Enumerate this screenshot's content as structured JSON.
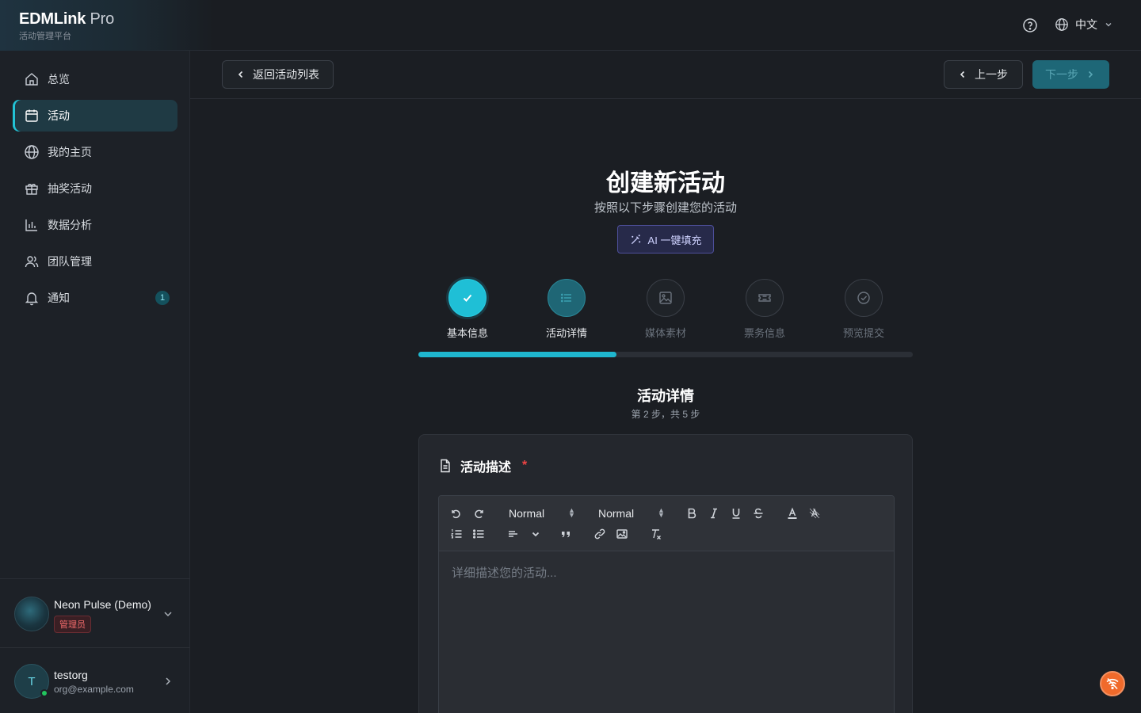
{
  "brand": {
    "name": "EDMLink",
    "suffix": "Pro",
    "subtitle": "活动管理平台"
  },
  "header": {
    "language": "中文"
  },
  "sidebar": {
    "items": [
      {
        "label": "总览",
        "icon": "home-icon"
      },
      {
        "label": "活动",
        "icon": "calendar-icon",
        "active": true
      },
      {
        "label": "我的主页",
        "icon": "globe-icon"
      },
      {
        "label": "抽奖活动",
        "icon": "gift-icon"
      },
      {
        "label": "数据分析",
        "icon": "bar-chart-icon"
      },
      {
        "label": "团队管理",
        "icon": "users-icon"
      },
      {
        "label": "通知",
        "icon": "bell-icon",
        "badge": "1"
      }
    ],
    "org": {
      "name": "Neon Pulse (Demo)",
      "role": "管理员"
    },
    "user": {
      "initial": "T",
      "name": "testorg",
      "email": "org@example.com"
    }
  },
  "actions": {
    "back": "返回活动列表",
    "prev": "上一步",
    "next": "下一步"
  },
  "page": {
    "title": "创建新活动",
    "subtitle": "按照以下步骤创建您的活动",
    "ai_fill": "AI 一键填充"
  },
  "steps": [
    {
      "label": "基本信息",
      "state": "done",
      "icon": "check-icon"
    },
    {
      "label": "活动详情",
      "state": "current",
      "icon": "list-icon"
    },
    {
      "label": "媒体素材",
      "state": "pending",
      "icon": "image-icon"
    },
    {
      "label": "票务信息",
      "state": "pending",
      "icon": "ticket-icon"
    },
    {
      "label": "预览提交",
      "state": "pending",
      "icon": "check-circle-icon"
    }
  ],
  "progress": {
    "fraction": 0.4
  },
  "section": {
    "title": "活动详情",
    "subtitle": "第 2 步，共 5 步"
  },
  "card": {
    "title": "活动描述",
    "required_mark": "*",
    "editor": {
      "font_select": "Normal",
      "size_select": "Normal",
      "placeholder": "详细描述您的活动..."
    }
  },
  "colors": {
    "accent": "#1fbfd6",
    "required": "#ef4444",
    "fab": "#f06a2b"
  }
}
